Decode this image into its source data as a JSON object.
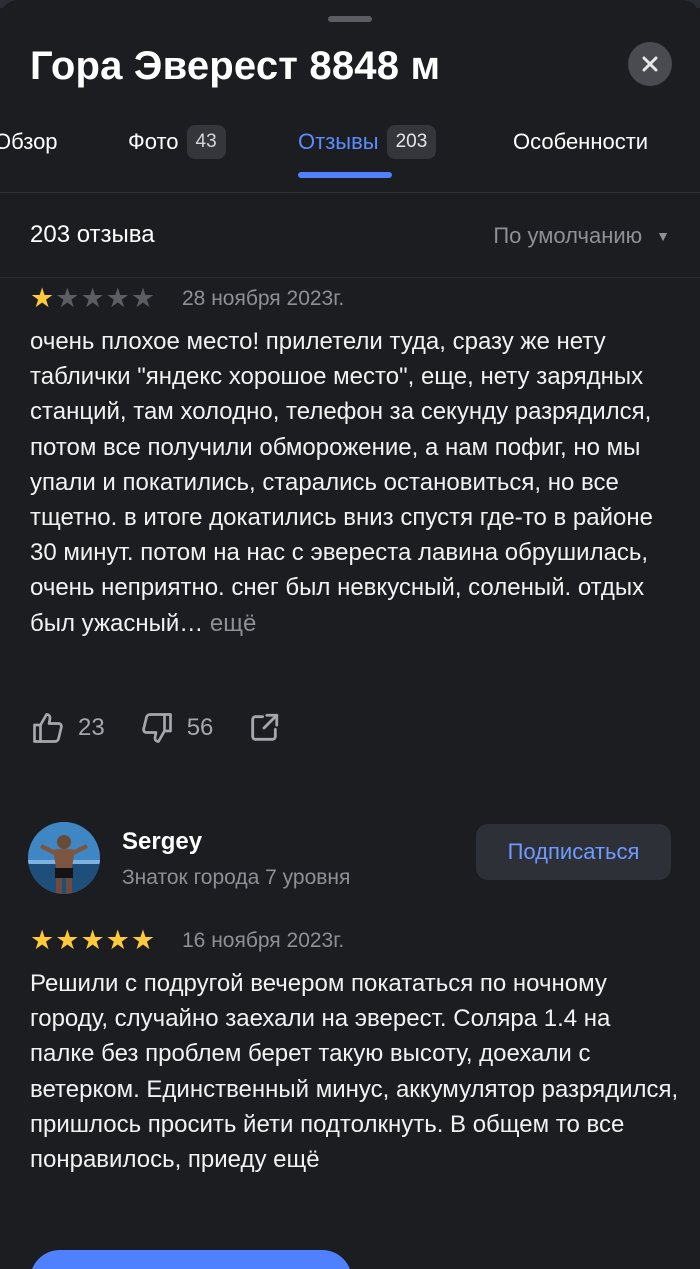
{
  "header": {
    "title": "Гора Эверест 8848 м"
  },
  "tabs": [
    {
      "label": "Обзор",
      "count": null
    },
    {
      "label": "Фото",
      "count": "43"
    },
    {
      "label": "Отзывы",
      "count": "203"
    },
    {
      "label": "Особенности",
      "count": null
    }
  ],
  "active_tab": "Отзывы",
  "reviews_header": {
    "count_label": "203 отзыва",
    "sort_label": "По умолчанию"
  },
  "reviews": [
    {
      "rating": 1,
      "date": "28 ноября 2023г.",
      "text": "очень плохое место! прилетели туда, сразу же нету таблички \"яндекс хорошое место\", еще, нету зарядных станций, там холодно, телефон за секунду разрядился, потом все получили обморожение, а нам пофиг, но мы упали и покатились, старались остановиться, но все тщетно. в итоге докатились вниз спустя где-то в районе 30 минут. потом на нас с эвереста лавина обрушилась, очень неприятно. снег был невкусный, соленый. отдых был ужасный…",
      "more_label": "ещё",
      "likes": "23",
      "dislikes": "56"
    },
    {
      "author": "Sergey",
      "author_level": "Знаток города 7 уровня",
      "subscribe_label": "Подписаться",
      "rating": 5,
      "date": "16 ноября 2023г.",
      "text": "Решили с подругой вечером покататься по ночному городу, случайно заехали на эверест. Соляра 1.4 на палке без проблем берет такую высоту, доехали с ветерком. Единственный минус, аккумулятор разрядился, пришлось просить йети подтолкнуть. В общем то все понравилось, приеду ещё"
    }
  ],
  "colors": {
    "accent": "#4f81ff",
    "star": "#ffc93c",
    "background": "#1c1d21"
  }
}
